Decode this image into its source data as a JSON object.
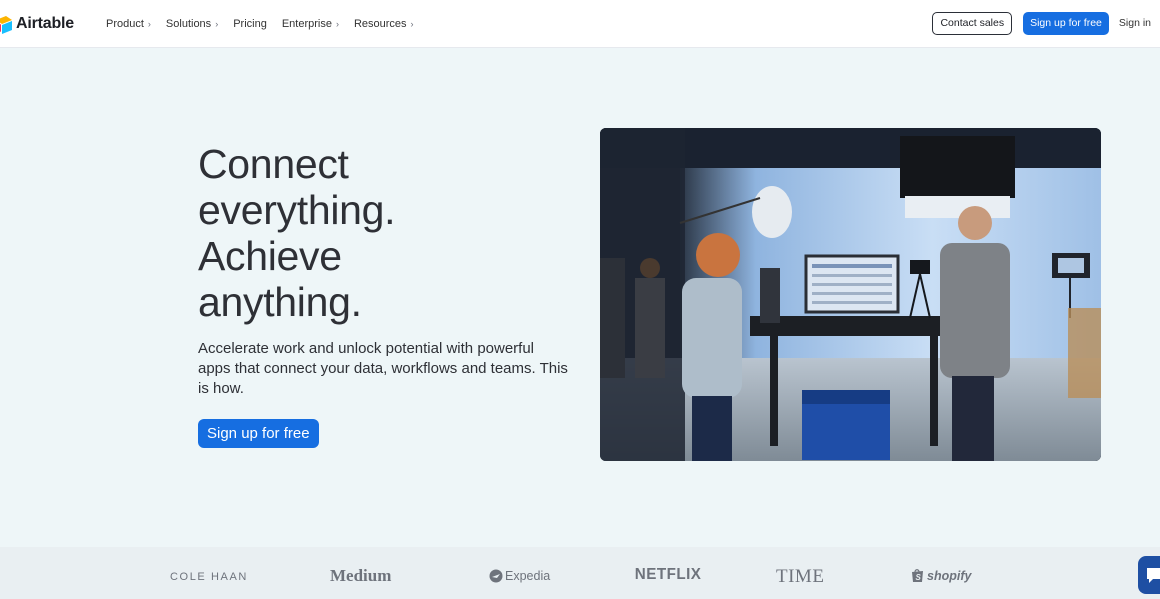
{
  "header": {
    "logo_text": "Airtable",
    "nav": [
      {
        "label": "Product",
        "has_chevron": true
      },
      {
        "label": "Solutions",
        "has_chevron": true
      },
      {
        "label": "Pricing",
        "has_chevron": false
      },
      {
        "label": "Enterprise",
        "has_chevron": true
      },
      {
        "label": "Resources",
        "has_chevron": true
      }
    ],
    "contact_sales": "Contact sales",
    "signup": "Sign up for free",
    "signin": "Sign in"
  },
  "hero": {
    "title_lines": [
      "Connect",
      "everything.",
      "Achieve",
      "anything."
    ],
    "subtitle": "Accelerate work and unlock potential with powerful apps that connect your data, workflows and teams. This is how.",
    "cta": "Sign up for free"
  },
  "logos": [
    "COLE HAAN",
    "Medium",
    "Expedia",
    "NETFLIX",
    "TIME",
    "shopify"
  ],
  "colors": {
    "accent": "#166ee1",
    "background": "#eef6f8",
    "header_bg": "#ffffff",
    "text": "#2e3036"
  },
  "icons": {
    "chevron": "›",
    "chat": "chat-icon"
  }
}
